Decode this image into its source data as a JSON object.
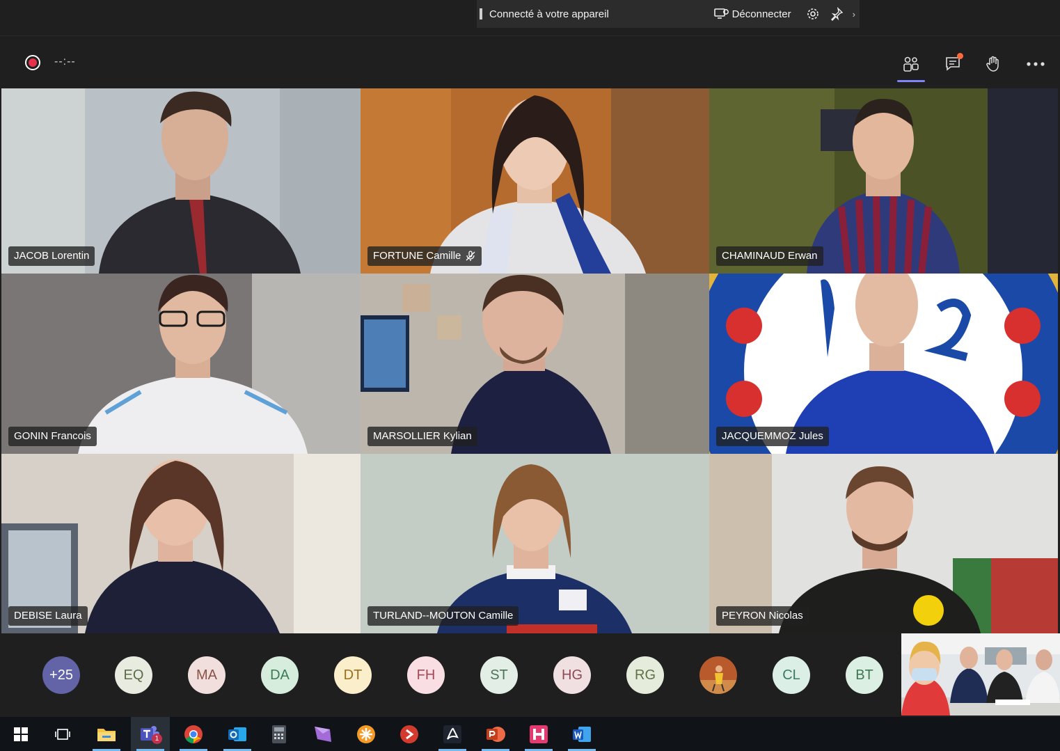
{
  "connection_bar": {
    "status_text": "Connecté à votre appareil",
    "disconnect_label": "Déconnecter",
    "icons": [
      "disconnect-icon",
      "settings-icon",
      "pin-icon",
      "chevron-right-icon"
    ]
  },
  "toolbar": {
    "timer": "--:--",
    "icons": [
      "record-icon",
      "participants-icon",
      "chat-icon",
      "raise-hand-icon",
      "more-options-icon"
    ]
  },
  "tiles": [
    {
      "name": "JACOB Lorentin",
      "muted": false
    },
    {
      "name": "FORTUNE Camille",
      "muted": true
    },
    {
      "name": "CHAMINAUD Erwan",
      "muted": false
    },
    {
      "name": "GONIN Francois",
      "muted": false
    },
    {
      "name": "MARSOLLIER Kylian",
      "muted": false
    },
    {
      "name": "JACQUEMMOZ Jules",
      "muted": false
    },
    {
      "name": "DEBISE Laura",
      "muted": false
    },
    {
      "name": "TURLAND--MOUTON Camille",
      "muted": false
    },
    {
      "name": "PEYRON Nicolas",
      "muted": false
    }
  ],
  "participant_strip": {
    "overflow_count": "+25",
    "avatars": [
      {
        "initials": "EQ",
        "bg": "#e8ebe0",
        "fg": "#5c6b4a"
      },
      {
        "initials": "MA",
        "bg": "#f0dfdc",
        "fg": "#8a5248"
      },
      {
        "initials": "DA",
        "bg": "#d6ecdd",
        "fg": "#3c7a55"
      },
      {
        "initials": "DT",
        "bg": "#fbeecb",
        "fg": "#98701c"
      },
      {
        "initials": "FH",
        "bg": "#f9dfe3",
        "fg": "#a24a5a"
      },
      {
        "initials": "ST",
        "bg": "#e3efe6",
        "fg": "#4c7357"
      },
      {
        "initials": "HG",
        "bg": "#f1e0e2",
        "fg": "#8b4a55"
      },
      {
        "initials": "RG",
        "bg": "#e6ecdc",
        "fg": "#5f7145"
      },
      {
        "initials": "",
        "photo": true
      },
      {
        "initials": "CL",
        "bg": "#dcefe6",
        "fg": "#3b7a5e"
      },
      {
        "initials": "BT",
        "bg": "#dcefe3",
        "fg": "#3d7755"
      }
    ]
  },
  "taskbar": {
    "teams_badge": "1",
    "apps": [
      "windows-start-icon",
      "task-view-icon",
      "file-explorer-icon",
      "teams-icon",
      "chrome-icon",
      "outlook-icon",
      "calculator-icon",
      "onenote-icon",
      "app-flower-icon",
      "remote-desktop-icon",
      "acrobat-icon",
      "powerpoint-icon",
      "h-app-icon",
      "word-icon"
    ]
  }
}
